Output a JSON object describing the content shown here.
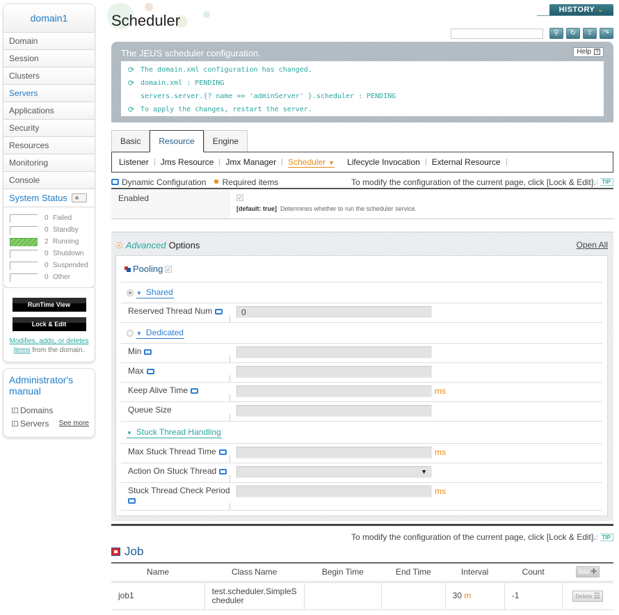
{
  "sidebar": {
    "domain_name": "domain1",
    "menu": [
      {
        "label": "Domain",
        "active": false
      },
      {
        "label": "Session",
        "active": false
      },
      {
        "label": "Clusters",
        "active": false
      },
      {
        "label": "Servers",
        "active": true
      },
      {
        "label": "Applications",
        "active": false
      },
      {
        "label": "Security",
        "active": false
      },
      {
        "label": "Resources",
        "active": false
      },
      {
        "label": "Monitoring",
        "active": false
      },
      {
        "label": "Console",
        "active": false
      }
    ],
    "system_status": {
      "title": "System Status",
      "rows": [
        {
          "count": "0",
          "label": "Failed"
        },
        {
          "count": "0",
          "label": "Standby"
        },
        {
          "count": "2",
          "label": "Running"
        },
        {
          "count": "0",
          "label": "Shutdown"
        },
        {
          "count": "0",
          "label": "Suspended"
        },
        {
          "count": "0",
          "label": "Other"
        }
      ]
    },
    "runtime_view_label": "RunTime View",
    "lock_edit_label": "Lock & Edit",
    "note_link": "Modifies, adds, or deletes items",
    "note_rest": " from the domain.",
    "manual": {
      "title": "Administrator's manual",
      "links": [
        "Domains",
        "Servers"
      ],
      "see_more": "See more"
    }
  },
  "header": {
    "page_title": "Scheduler",
    "history_label": "HISTORY",
    "search_placeholder": "",
    "tool_buttons": [
      "search",
      "refresh",
      "xml-export",
      "config-export"
    ]
  },
  "info": {
    "title": "The JEUS scheduler configuration.",
    "help_label": "Help",
    "lines": [
      {
        "text": "The domain.xml configuration has changed.",
        "icon": true
      },
      {
        "text": "domain.xml : PENDING",
        "icon": true
      },
      {
        "text": "servers.server.{? name == 'adminServer' }.scheduler : PENDING",
        "icon": false
      },
      {
        "text": "To apply the changes, restart the server.",
        "icon": true
      }
    ]
  },
  "tabs": [
    {
      "label": "Basic",
      "active": false
    },
    {
      "label": "Resource",
      "active": true
    },
    {
      "label": "Engine",
      "active": false
    }
  ],
  "subnav": [
    {
      "label": "Listener",
      "active": false
    },
    {
      "label": "Jms Resource",
      "active": false
    },
    {
      "label": "Jmx Manager",
      "active": false
    },
    {
      "label": "Scheduler",
      "active": true
    },
    {
      "label": "Lifecycle Invocation",
      "active": false
    },
    {
      "label": "External Resource",
      "active": false
    }
  ],
  "legend": {
    "dynamic": "Dynamic Configuration",
    "required": "Required items",
    "tip_text": "To modify the configuration of the current page, click [Lock & Edit].",
    "tip_badge": "TIP"
  },
  "enabled": {
    "label": "Enabled",
    "checked": true,
    "default_text": "[default: true]",
    "description": "Determines whether to run the scheduler service."
  },
  "advanced": {
    "prefix": "Advanced",
    "title": "Options",
    "open_all": "Open All",
    "pooling_label": "Pooling",
    "shared": {
      "label": "Shared",
      "selected": true,
      "fields": [
        {
          "label": "Reserved Thread Num",
          "value": "0",
          "dynamic": true,
          "unit": ""
        }
      ]
    },
    "dedicated": {
      "label": "Dedicated",
      "selected": false,
      "fields": [
        {
          "label": "Min",
          "value": "",
          "dynamic": true,
          "unit": ""
        },
        {
          "label": "Max",
          "value": "",
          "dynamic": true,
          "unit": ""
        },
        {
          "label": "Keep Alive Time",
          "value": "",
          "dynamic": true,
          "unit": "ms"
        },
        {
          "label": "Queue Size",
          "value": "",
          "dynamic": false,
          "unit": ""
        }
      ]
    },
    "stuck": {
      "label": "Stuck Thread Handling",
      "fields": [
        {
          "label": "Max Stuck Thread Time",
          "value": "",
          "dynamic": true,
          "unit": "ms"
        },
        {
          "label": "Action On Stuck Thread",
          "value": "",
          "dynamic": true,
          "unit": "",
          "select": true
        },
        {
          "label": "Stuck Thread Check Period",
          "value": "",
          "dynamic": true,
          "unit": "ms"
        }
      ]
    }
  },
  "job": {
    "tip_text": "To modify the configuration of the current page, click [Lock & Edit].",
    "tip_badge": "TIP",
    "title": "Job",
    "columns": [
      "Name",
      "Class Name",
      "Begin Time",
      "End Time",
      "Interval",
      "Count"
    ],
    "add_label": "Add",
    "delete_label": "Delete",
    "rows": [
      {
        "name": "job1",
        "class_name": "test.scheduler.SimpleS cheduler",
        "begin_time": "",
        "end_time": "",
        "interval_value": "30",
        "interval_unit": "m",
        "count": "-1"
      }
    ]
  }
}
